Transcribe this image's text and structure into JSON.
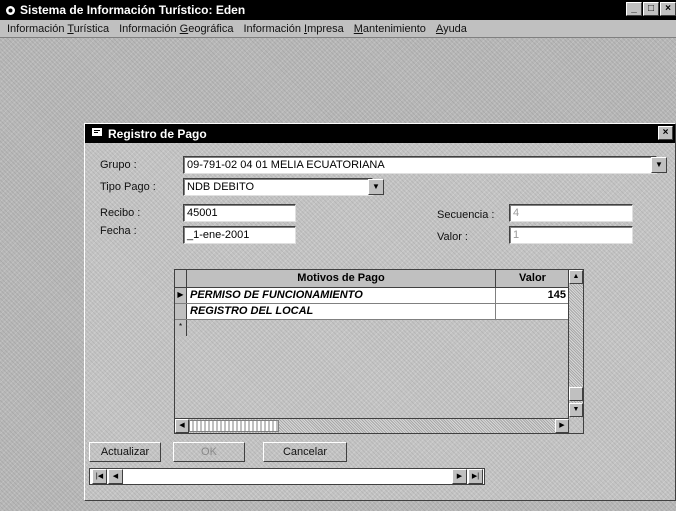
{
  "window": {
    "title": "Sistema de Información Turístico: Eden"
  },
  "menu": {
    "items": [
      {
        "pre": "Información ",
        "key": "T",
        "post": "urística"
      },
      {
        "pre": "Información ",
        "key": "G",
        "post": "eográfica"
      },
      {
        "pre": "Información ",
        "key": "I",
        "post": "mpresa"
      },
      {
        "pre": "",
        "key": "M",
        "post": "antenimiento"
      },
      {
        "pre": "",
        "key": "A",
        "post": "yuda"
      }
    ]
  },
  "dialog": {
    "title": "Registro de Pago",
    "labels": {
      "grupo": "Grupo :",
      "tipo_pago": "Tipo Pago :",
      "recibo": "Recibo :",
      "fecha": "Fecha :",
      "secuencia": "Secuencia :",
      "valor": "Valor :"
    },
    "fields": {
      "grupo": "09-791-02 04 01 MELIA ECUATORIANA",
      "tipo_pago": "NDB DEBITO",
      "recibo": "45001",
      "fecha": "_1-ene-2001",
      "secuencia": "4",
      "valor": "1"
    },
    "grid": {
      "columns": [
        "Motivos de Pago",
        "Valor"
      ],
      "rows": [
        {
          "motivo": "PERMISO DE FUNCIONAMIENTO",
          "valor": "145"
        },
        {
          "motivo": "REGISTRO DEL LOCAL",
          "valor": ""
        }
      ]
    },
    "buttons": {
      "actualizar": "Actualizar",
      "ok": "OK",
      "cancelar": "Cancelar"
    }
  },
  "icons": {
    "app": "app-icon",
    "dialog": "dialog-icon",
    "minimize": "minimize-icon",
    "maximize": "maximize-icon",
    "close": "close-icon",
    "row_pointer": "row-pointer-icon",
    "new_row": "new-row-icon"
  },
  "colors": {
    "titlebar": "#000000",
    "face": "#c0c0c0",
    "field": "#ffffff"
  }
}
